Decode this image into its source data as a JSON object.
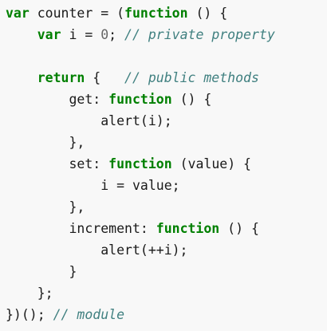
{
  "code": {
    "lines": [
      {
        "indent": "",
        "tokens": [
          {
            "t": "kw",
            "v": "var"
          },
          {
            "t": "tx",
            "v": " counter = ("
          },
          {
            "t": "kw",
            "v": "function"
          },
          {
            "t": "tx",
            "v": " () {"
          }
        ]
      },
      {
        "indent": "    ",
        "tokens": [
          {
            "t": "kw",
            "v": "var"
          },
          {
            "t": "tx",
            "v": " i = "
          },
          {
            "t": "nm",
            "v": "0"
          },
          {
            "t": "tx",
            "v": "; "
          },
          {
            "t": "cm",
            "v": "// private property"
          }
        ]
      },
      {
        "indent": "",
        "tokens": []
      },
      {
        "indent": "    ",
        "tokens": [
          {
            "t": "kw",
            "v": "return"
          },
          {
            "t": "tx",
            "v": " {   "
          },
          {
            "t": "cm",
            "v": "// public methods"
          }
        ]
      },
      {
        "indent": "        ",
        "tokens": [
          {
            "t": "at",
            "v": "get"
          },
          {
            "t": "tx",
            "v": ": "
          },
          {
            "t": "kw",
            "v": "function"
          },
          {
            "t": "tx",
            "v": " () {"
          }
        ]
      },
      {
        "indent": "            ",
        "tokens": [
          {
            "t": "tx",
            "v": "alert(i);"
          }
        ]
      },
      {
        "indent": "        ",
        "tokens": [
          {
            "t": "tx",
            "v": "},"
          }
        ]
      },
      {
        "indent": "        ",
        "tokens": [
          {
            "t": "at",
            "v": "set"
          },
          {
            "t": "tx",
            "v": ": "
          },
          {
            "t": "kw",
            "v": "function"
          },
          {
            "t": "tx",
            "v": " (value) {"
          }
        ]
      },
      {
        "indent": "            ",
        "tokens": [
          {
            "t": "tx",
            "v": "i = value;"
          }
        ]
      },
      {
        "indent": "        ",
        "tokens": [
          {
            "t": "tx",
            "v": "},"
          }
        ]
      },
      {
        "indent": "        ",
        "tokens": [
          {
            "t": "at",
            "v": "increment"
          },
          {
            "t": "tx",
            "v": ": "
          },
          {
            "t": "kw",
            "v": "function"
          },
          {
            "t": "tx",
            "v": " () {"
          }
        ]
      },
      {
        "indent": "            ",
        "tokens": [
          {
            "t": "tx",
            "v": "alert(++i);"
          }
        ]
      },
      {
        "indent": "        ",
        "tokens": [
          {
            "t": "tx",
            "v": "}"
          }
        ]
      },
      {
        "indent": "    ",
        "tokens": [
          {
            "t": "tx",
            "v": "};"
          }
        ]
      },
      {
        "indent": "",
        "tokens": [
          {
            "t": "tx",
            "v": "})(); "
          },
          {
            "t": "cm",
            "v": "// module"
          }
        ]
      }
    ]
  },
  "colors": {
    "keyword": "#008000",
    "comment": "#408080",
    "text": "#1a1a1a",
    "number": "#666666",
    "background": "#f8f8f8"
  }
}
